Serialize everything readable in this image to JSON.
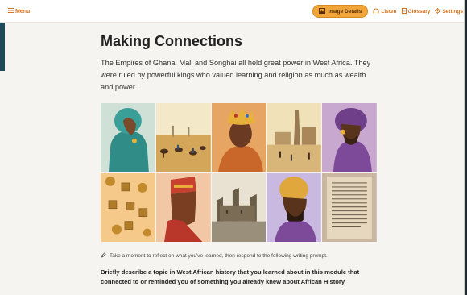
{
  "topbar": {
    "menu_label": "Menu",
    "image_details_label": "Image Details",
    "listen_label": "Listen",
    "glossary_label": "Glossary",
    "settings_label": "Settings"
  },
  "main": {
    "title": "Making Connections",
    "intro": "The Empires of Ghana, Mali and Songhai all held great power in West Africa. They were ruled by powerful kings who valued learning and religion as much as wealth and power.",
    "prompt_instruction": "Take a moment to reflect on what you've learned, then respond to the following writing prompt.",
    "question": "Briefly describe a topic in West African history that you learned about in this module that connected to or reminded you of something you already knew about African History."
  },
  "colors": {
    "accent": "#d9731c",
    "pill": "#f0a63a",
    "background": "#f6f4f0"
  },
  "icons": [
    "menu-icon",
    "image-icon",
    "headphones-icon",
    "glossary-icon",
    "gear-icon",
    "pencil-icon"
  ]
}
